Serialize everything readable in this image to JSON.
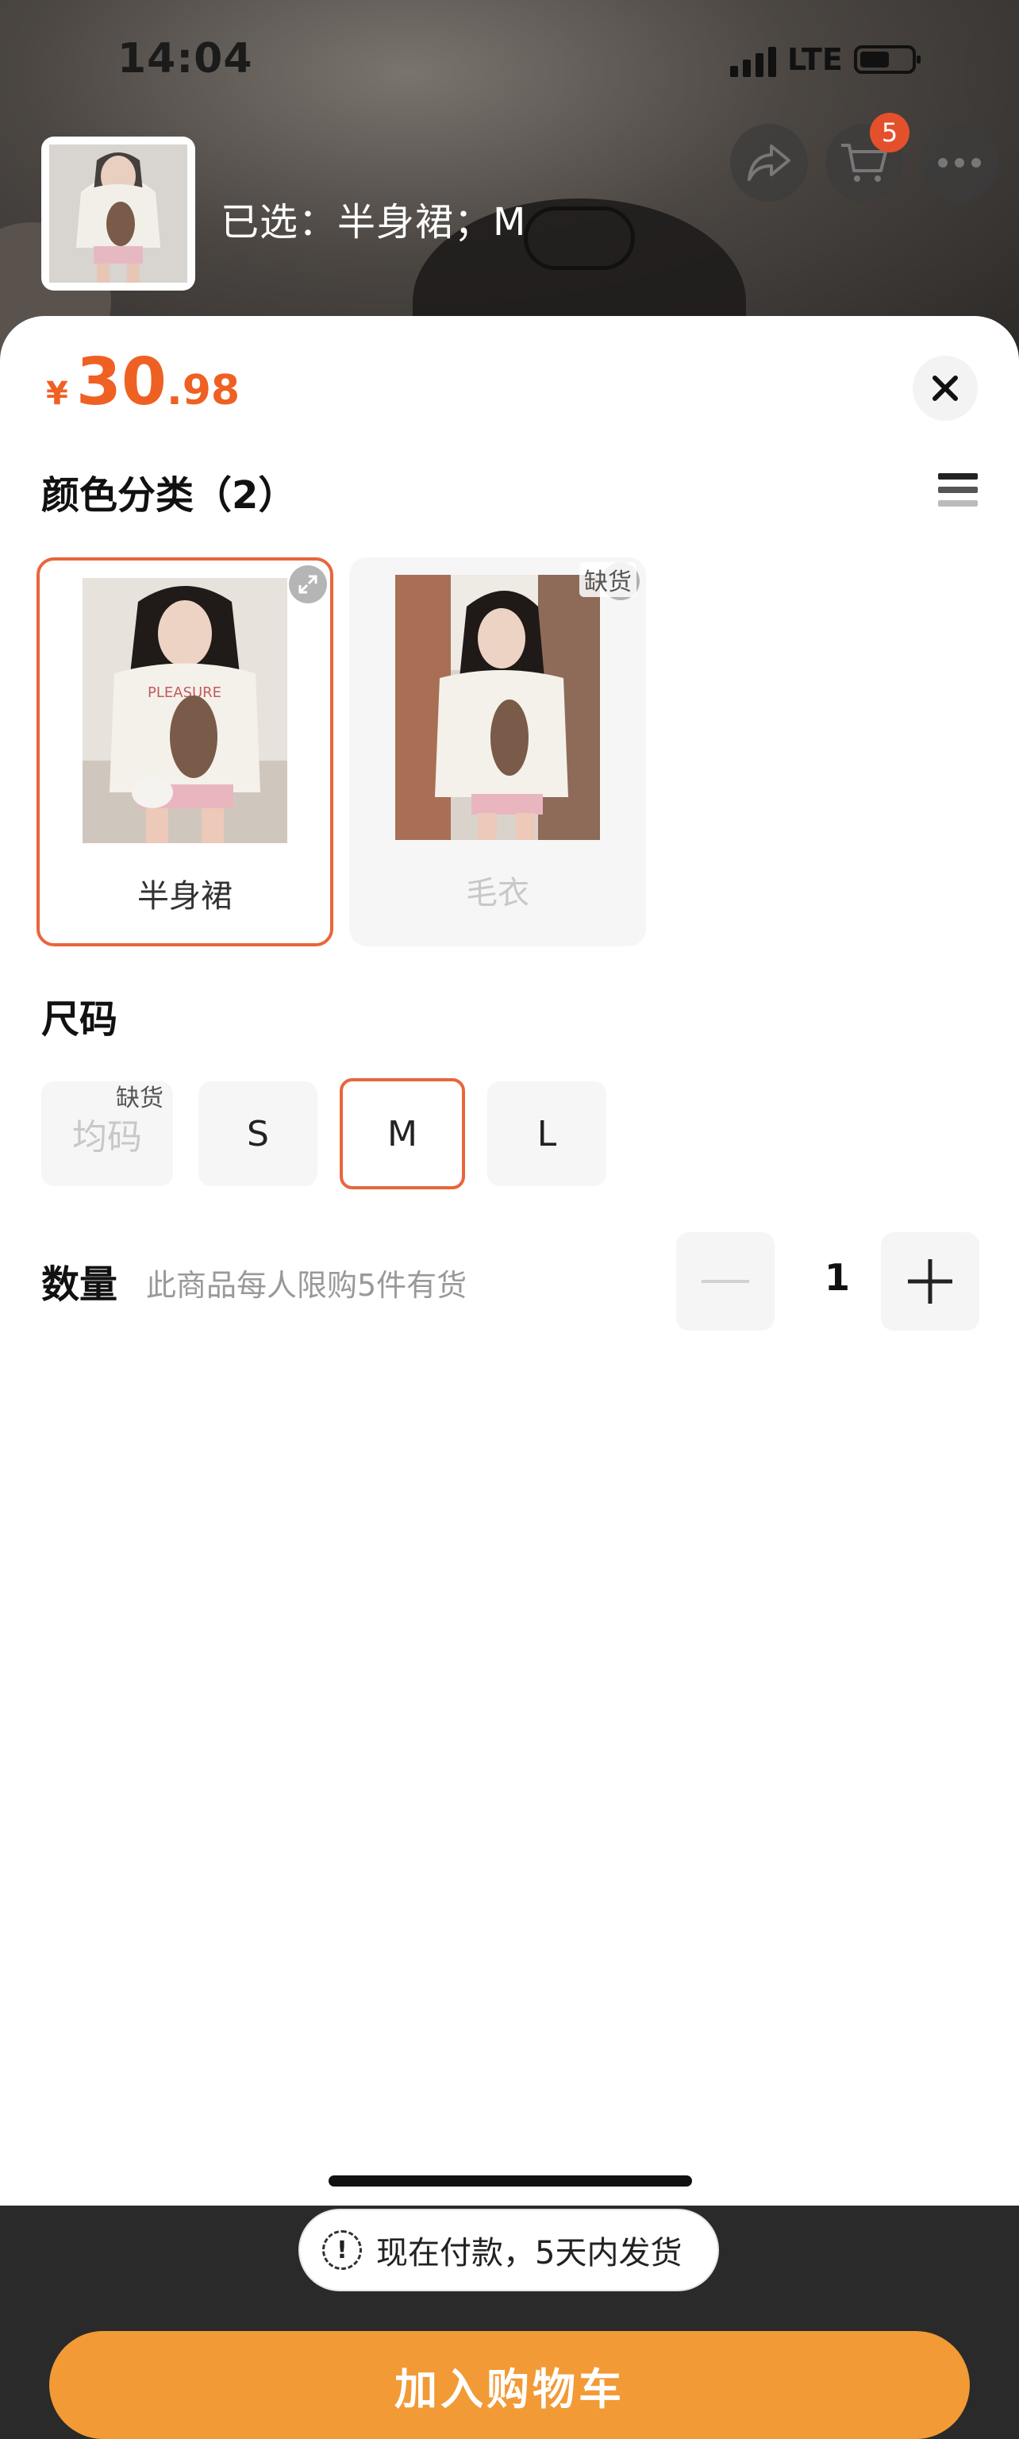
{
  "status_bar": {
    "time": "14:04",
    "network": "LTE"
  },
  "header": {
    "selected_prefix": "已选：",
    "selected_value": "半身裙；M",
    "cart_count": "5"
  },
  "icons": {
    "share": "share-icon",
    "cart": "cart-icon",
    "more": "more-icon",
    "close": "close-icon",
    "list": "list-view-icon",
    "expand": "expand-icon",
    "minus": "minus-icon",
    "plus": "plus-icon",
    "info": "exclamation-icon"
  },
  "price": {
    "currency": "¥",
    "integer": "30",
    "decimal": ".98"
  },
  "colors_section": {
    "title": "颜色分类（2）",
    "options": [
      {
        "label": "半身裙",
        "selected": true,
        "out_of_stock": false
      },
      {
        "label": "毛衣",
        "selected": false,
        "out_of_stock": true,
        "tag": "缺货"
      }
    ]
  },
  "size_section": {
    "title": "尺码",
    "options": [
      {
        "label": "均码",
        "out_of_stock": true,
        "tag": "缺货"
      },
      {
        "label": "S"
      },
      {
        "label": "M",
        "selected": true
      },
      {
        "label": "L"
      }
    ]
  },
  "quantity": {
    "label": "数量",
    "note": "此商品每人限购5件有货",
    "value": "1"
  },
  "notice": {
    "text": "现在付款，5天内发货"
  },
  "cta": {
    "label": "加入购物车"
  },
  "theme": {
    "accent": "#ef6023",
    "border_accent": "#e8663a",
    "cta_bg": "#f29a36"
  }
}
